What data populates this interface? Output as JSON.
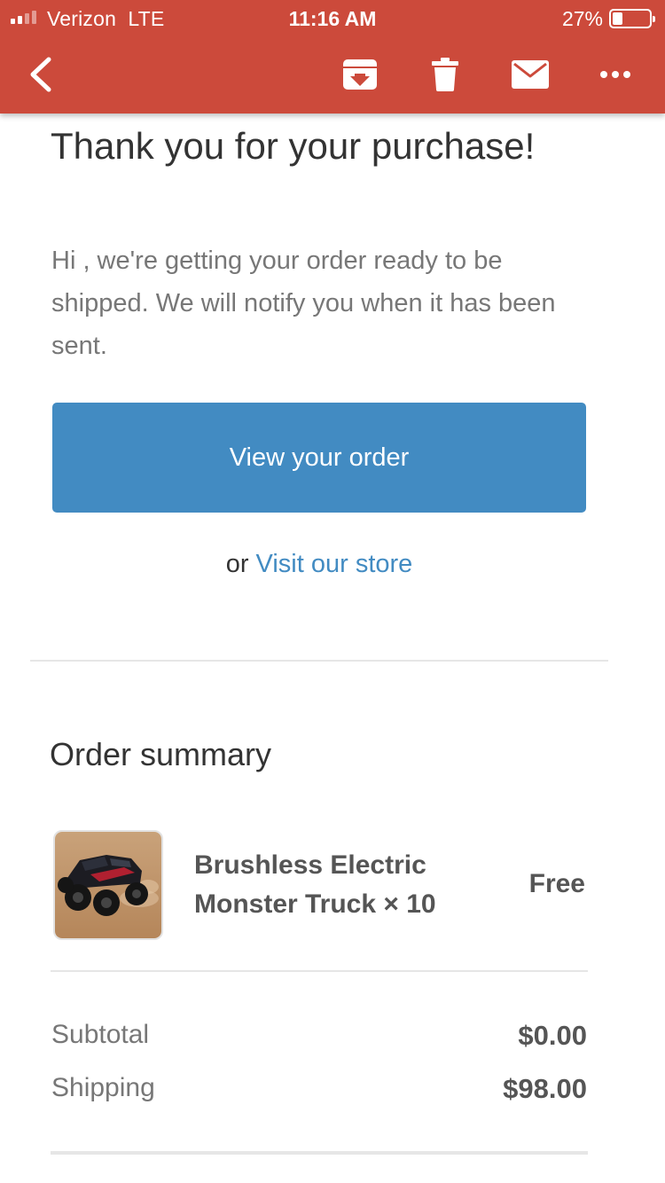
{
  "status_bar": {
    "carrier": "Verizon",
    "network": "LTE",
    "time": "11:16 AM",
    "battery_percent": "27%",
    "battery_level": 0.27,
    "signal_bars_filled": 2,
    "signal_bars_total": 4
  },
  "toolbar": {
    "back_icon": "chevron-left-icon",
    "archive_icon": "archive-icon",
    "trash_icon": "trash-icon",
    "mail_icon": "mail-icon",
    "more_icon": "more-horizontal-icon"
  },
  "email": {
    "title": "Thank you for your purchase!",
    "intro": "Hi , we're getting your order ready to be shipped. We will notify you when it has been sent.",
    "view_order_button": "View your order",
    "or_text": "or",
    "visit_store_link": "Visit our store",
    "order_summary_title": "Order summary",
    "product": {
      "name": "Brushless Electric Monster Truck × 10",
      "price": "Free"
    },
    "totals": [
      {
        "label": "Subtotal",
        "value": "$0.00"
      },
      {
        "label": "Shipping",
        "value": "$98.00"
      }
    ]
  },
  "colors": {
    "header_red": "#cc4a3b",
    "button_blue": "#428bc2",
    "link_blue": "#428bc2",
    "text_dark": "#333333",
    "text_gray": "#777777"
  }
}
